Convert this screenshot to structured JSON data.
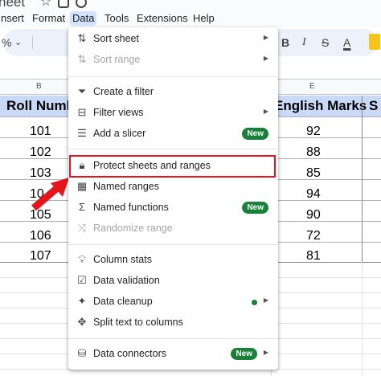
{
  "doc": {
    "title": "heet"
  },
  "menubar": [
    "nsert",
    "Format",
    "Data",
    "Tools",
    "Extensions",
    "Help"
  ],
  "toolbar": {
    "percent": "%",
    "dropdown": "⌄",
    "bold": "B",
    "italic": "I",
    "strike": "S",
    "textcolor": "A"
  },
  "columns": {
    "b": "B",
    "e": "E"
  },
  "sheet": {
    "headers": {
      "roll": "Roll Numbe",
      "english": "English Marks",
      "extra": "S"
    },
    "rolls": [
      "101",
      "102",
      "103",
      "10",
      "105",
      "106",
      "107"
    ],
    "english": [
      "92",
      "88",
      "85",
      "94",
      "90",
      "72",
      "81"
    ]
  },
  "menu": {
    "sort_sheet": "Sort sheet",
    "sort_range": "Sort range",
    "create_filter": "Create a filter",
    "filter_views": "Filter views",
    "add_slicer": "Add a slicer",
    "protect": "Protect sheets and ranges",
    "named_ranges": "Named ranges",
    "named_functions": "Named functions",
    "randomize": "Randomize range",
    "column_stats": "Column stats",
    "data_validation": "Data validation",
    "data_cleanup": "Data cleanup",
    "split_text": "Split text to columns",
    "data_connectors": "Data connectors",
    "new_badge": "New"
  },
  "colors": {
    "accent_green": "#188038",
    "highlight_red": "#e5161b",
    "header_blue": "#c9daf8"
  }
}
